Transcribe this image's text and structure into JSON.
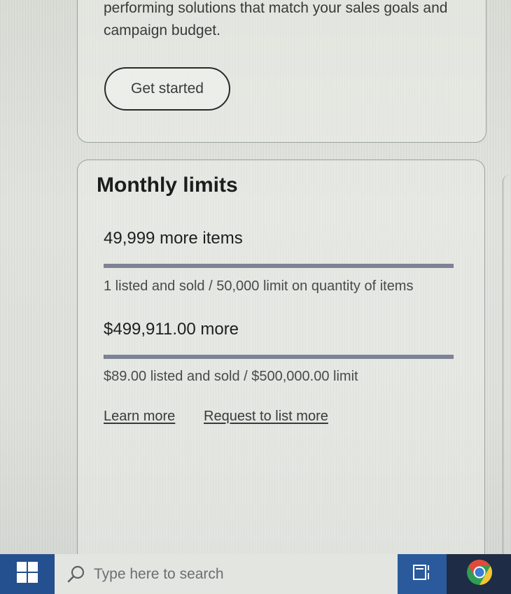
{
  "promo": {
    "text": "performing solutions that match your sales goals and campaign budget.",
    "button_label": "Get started"
  },
  "monthly_limits": {
    "title": "Monthly limits",
    "items": {
      "remaining": "49,999 more items",
      "detail": "1 listed and sold / 50,000 limit on quantity of items",
      "used_fraction": 2e-05
    },
    "money": {
      "remaining": "$499,911.00 more",
      "detail": "$89.00 listed and sold / $500,000.00 limit",
      "used_fraction": 0.000178
    },
    "links": {
      "learn_more": "Learn more",
      "request_more": "Request to list more"
    }
  },
  "taskbar": {
    "search_placeholder": "Type here to search",
    "start_icon": "windows-logo-icon",
    "search_icon": "search-icon",
    "task_view_icon": "task-view-icon",
    "app_icon": "chrome-icon"
  },
  "colors": {
    "taskbar": "#1f2c45",
    "start_button": "#25508f",
    "progress_bar": "#6b6f7c"
  }
}
